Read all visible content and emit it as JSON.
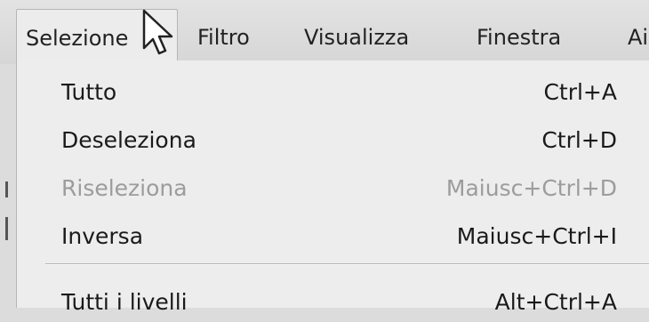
{
  "menubar": {
    "items": [
      {
        "label": "Selezione",
        "active": true
      },
      {
        "label": "Filtro"
      },
      {
        "label": "Visualizza"
      },
      {
        "label": "Finestra"
      },
      {
        "label": "Ai"
      }
    ]
  },
  "menu": {
    "items": [
      {
        "label": "Tutto",
        "shortcut": "Ctrl+A",
        "enabled": true
      },
      {
        "label": "Deseleziona",
        "shortcut": "Ctrl+D",
        "enabled": true
      },
      {
        "label": "Riseleziona",
        "shortcut": "Maiusc+Ctrl+D",
        "enabled": false
      },
      {
        "label": "Inversa",
        "shortcut": "Maiusc+Ctrl+I",
        "enabled": true
      },
      {
        "label": "Tutti i livelli",
        "shortcut": "Alt+Ctrl+A",
        "enabled": true
      }
    ]
  },
  "colors": {
    "menubar_bg": "#dcdcdc",
    "menu_bg": "#ededed",
    "text": "#1a1a1a",
    "disabled_text": "#9c9c9c"
  },
  "icons": {
    "cursor": "arrow-pointer-icon"
  }
}
